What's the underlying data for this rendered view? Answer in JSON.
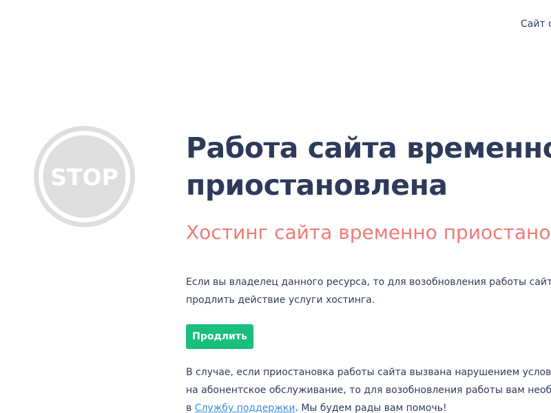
{
  "header": {
    "site_link": "Сайт о"
  },
  "stop_sign": {
    "text": "STOP",
    "ring_color": "#dedede",
    "fill_color": "#dedede"
  },
  "main": {
    "headline_line1": "Работа сайта временно",
    "headline_line2": "приостановлена",
    "subheadline": "Хостинг сайта временно приостановлен",
    "paragraph1_line1": "Если вы владелец данного ресурса, то для возобновления работы сайта вам необходимо",
    "paragraph1_line2": "продлить действие услуги хостинга.",
    "renew_button": "Продлить",
    "paragraph2_line1": "В случае, если приостановка работы сайта вызвана нарушением условий договора",
    "paragraph2_line2": "на абонентское обслуживание, то для возобновления работы вам необходимо обратиться",
    "paragraph2_line3_prefix": "в ",
    "support_link": "Службу поддержки",
    "paragraph2_line3_suffix": ". Мы будем рады вам помочь!"
  },
  "colors": {
    "text": "#2d3a5a",
    "accent_red": "#f07a76",
    "button_green": "#19bf7d",
    "link_blue": "#3b8fd6"
  }
}
